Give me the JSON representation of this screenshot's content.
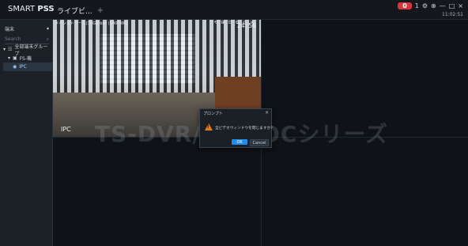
{
  "app": {
    "logo_prefix": "SMART ",
    "logo_suffix": "PSS",
    "tab_label": "ライブビ...",
    "tab_add": "+"
  },
  "top_right": {
    "alarm_count": "0",
    "status_icons": [
      "1",
      "⚙",
      "⊕",
      "—",
      "□",
      "×"
    ],
    "time": "11:02:51"
  },
  "sidebar": {
    "filter_label": "端末",
    "filter_dropdown_icon": "chevron-down-icon",
    "search_placeholder": "Search",
    "search_icon": "search-icon",
    "tree": {
      "root": "全部端末グループ",
      "group": "FS-機",
      "device": "IPC"
    }
  },
  "video": {
    "stream_label": "メインストリーム(30GB)bps (640*480)",
    "timestamp": "24:56",
    "overlay_icons": [
      "⟲",
      "⊞",
      "⊡",
      "⚙",
      "◎",
      "×"
    ],
    "channel_name": "IPC"
  },
  "watermark": {
    "text": "TS-DVR/TS-POCシリーズ"
  },
  "dialog": {
    "title": "プロンプト",
    "message": "全ビデオウィンドウを閉じますか?",
    "ok_label": "OK",
    "cancel_label": "Cancel"
  },
  "colors": {
    "accent_blue": "#1e8de8",
    "alarm_red": "#d6373d",
    "warning_orange": "#e07a1f"
  }
}
